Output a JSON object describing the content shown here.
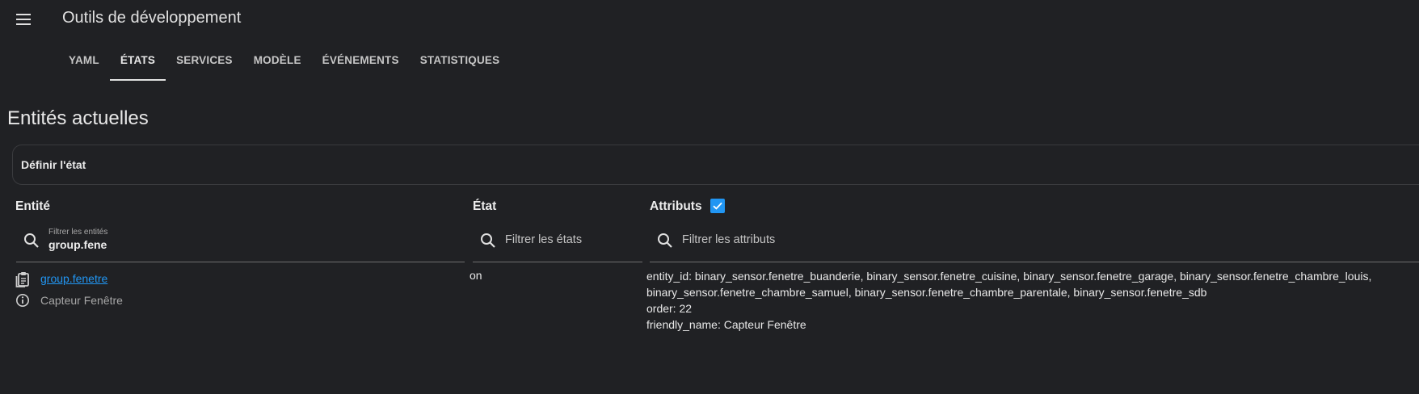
{
  "app": {
    "title": "Outils de développement"
  },
  "tabs": [
    {
      "label": "YAML"
    },
    {
      "label": "ÉTATS"
    },
    {
      "label": "SERVICES"
    },
    {
      "label": "MODÈLE"
    },
    {
      "label": "ÉVÉNEMENTS"
    },
    {
      "label": "STATISTIQUES"
    }
  ],
  "active_tab": "ÉTATS",
  "section": {
    "title": "Entités actuelles",
    "set_state_label": "Définir l'état"
  },
  "columns": {
    "entity": "Entité",
    "state": "État",
    "attributes": "Attributs",
    "attributes_checked": true
  },
  "filters": {
    "entity": {
      "label": "Filtrer les entités",
      "value": "group.fene"
    },
    "state": {
      "placeholder": "Filtrer les états"
    },
    "attributes": {
      "placeholder": "Filtrer les attributs"
    }
  },
  "rows": [
    {
      "entity_id": "group.fenetre",
      "friendly_name": "Capteur Fenêtre",
      "state": "on",
      "attributes": [
        "entity_id: binary_sensor.fenetre_buanderie, binary_sensor.fenetre_cuisine, binary_sensor.fenetre_garage, binary_sensor.fenetre_chambre_louis,",
        "binary_sensor.fenetre_chambre_samuel, binary_sensor.fenetre_chambre_parentale, binary_sensor.fenetre_sdb",
        "order: 22",
        "friendly_name: Capteur Fenêtre"
      ]
    }
  ],
  "icons": {
    "menu": "menu-icon",
    "search": "search-icon",
    "clipboard": "clipboard-icon",
    "info": "info-icon",
    "check": "check-icon"
  },
  "colors": {
    "background": "#202124",
    "accent": "#2196f3",
    "text": "#e1e1e1"
  }
}
